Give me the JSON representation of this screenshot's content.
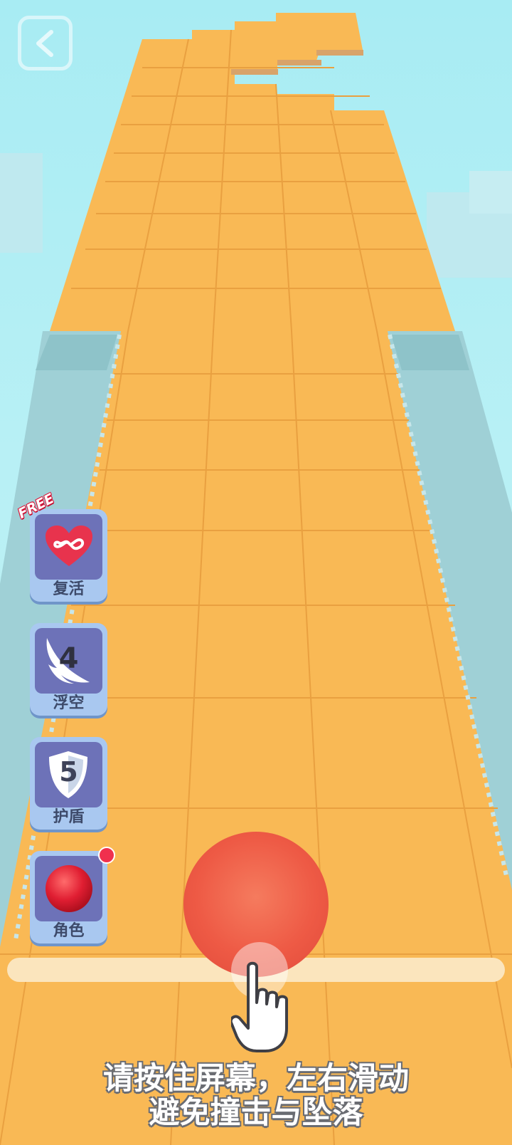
{
  "nav": {
    "back_icon": "chevron-left-icon"
  },
  "skills": [
    {
      "label": "复活",
      "icon": "infinity-heart-icon",
      "badge": "FREE"
    },
    {
      "label": "浮空",
      "icon": "wing-icon",
      "count": "4"
    },
    {
      "label": "护盾",
      "icon": "shield-icon",
      "count": "5"
    },
    {
      "label": "角色",
      "icon": "red-ball-icon",
      "notification": true
    }
  ],
  "player": {
    "icon": "red-ball",
    "color": "#ee5a45"
  },
  "hint": {
    "line1": "请按住屏幕，左右滑动",
    "line2": "避免撞击与坠落"
  },
  "colors": {
    "tile": "#f9b955",
    "tile_line": "#e9a040",
    "sky": "#a8ecf3",
    "button_bg": "#6d72b8",
    "button_frame": "#a9c8f0"
  }
}
